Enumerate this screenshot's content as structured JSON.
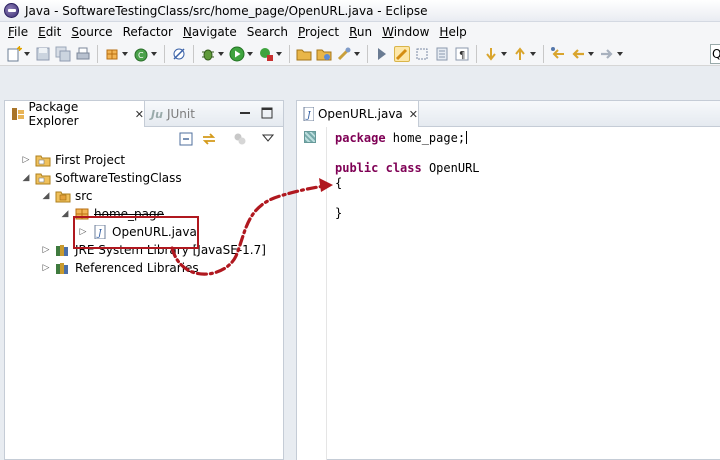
{
  "window": {
    "title": "Java - SoftwareTestingClass/src/home_page/OpenURL.java - Eclipse"
  },
  "menu": [
    {
      "label": "File",
      "mnemonic": "F",
      "rest": "ile"
    },
    {
      "label": "Edit",
      "mnemonic": "E",
      "rest": "dit"
    },
    {
      "label": "Source",
      "mnemonic": "S",
      "rest": "ource"
    },
    {
      "label": "Refactor",
      "mnemonic": "",
      "rest": "Refactor"
    },
    {
      "label": "Navigate",
      "mnemonic": "N",
      "rest": "avigate"
    },
    {
      "label": "Search",
      "mnemonic": "",
      "rest": "Search"
    },
    {
      "label": "Project",
      "mnemonic": "P",
      "rest": "roject"
    },
    {
      "label": "Run",
      "mnemonic": "R",
      "rest": "un"
    },
    {
      "label": "Window",
      "mnemonic": "W",
      "rest": "indow"
    },
    {
      "label": "Help",
      "mnemonic": "H",
      "rest": "elp"
    }
  ],
  "toolbar": {
    "quick_access": "Q"
  },
  "package_explorer": {
    "tab_label": "Package Explorer",
    "junit_tab_label": "JUnit",
    "tree": [
      {
        "label": "First Project",
        "icon": "project-folder-icon",
        "twisty": "collapsed",
        "level": 0
      },
      {
        "label": "SoftwareTestingClass",
        "icon": "project-folder-icon",
        "twisty": "expanded",
        "level": 0
      },
      {
        "label": "src",
        "icon": "source-folder-icon",
        "twisty": "expanded",
        "level": 1
      },
      {
        "label": "home_page",
        "icon": "package-icon",
        "twisty": "expanded",
        "level": 2
      },
      {
        "label": "OpenURL.java",
        "icon": "java-file-icon",
        "twisty": "collapsed",
        "level": 3
      },
      {
        "label": "JRE System Library [JavaSE-1.7]",
        "icon": "library-icon",
        "twisty": "collapsed",
        "level": 1
      },
      {
        "label": "Referenced Libraries",
        "icon": "library-icon",
        "twisty": "collapsed",
        "level": 1
      }
    ]
  },
  "editor": {
    "tab_label": "OpenURL.java",
    "code": {
      "line1_kw": "package",
      "line1_rest": " home_page;",
      "line3_kw1": "public",
      "line3_kw2": "class",
      "line3_rest": " OpenURL",
      "line4": "{",
      "line6": "}"
    }
  },
  "colors": {
    "annotation": "#b0181f",
    "keyword": "#7f0055"
  }
}
